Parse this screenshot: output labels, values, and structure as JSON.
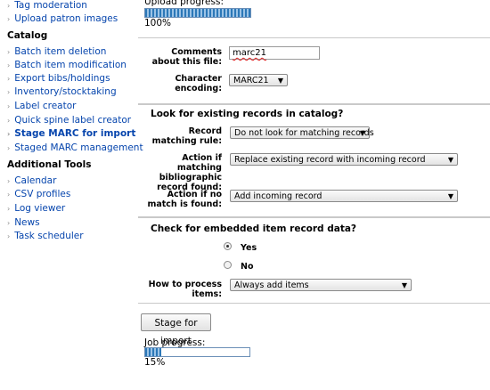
{
  "sidebar": {
    "top_items": [
      "Tag moderation",
      "Upload patron images"
    ],
    "catalog_heading": "Catalog",
    "catalog_items": [
      "Batch item deletion",
      "Batch item modification",
      "Export bibs/holdings",
      "Inventory/stocktaking",
      "Label creator",
      "Quick spine label creator",
      "Stage MARC for import",
      "Staged MARC management"
    ],
    "tools_heading": "Additional Tools",
    "tools_items": [
      "Calendar",
      "CSV profiles",
      "Log viewer",
      "News",
      "Task scheduler"
    ]
  },
  "upload": {
    "label": "Upload progress:",
    "percent": "100%",
    "fraction": 1.0
  },
  "file_info": {
    "comments_label": "Comments about this file:",
    "comments_value": "marc21",
    "encoding_label": "Character encoding:",
    "encoding_value": "MARC21"
  },
  "matching": {
    "legend": "Look for existing records in catalog?",
    "rule_label": "Record matching rule:",
    "rule_value": "Do not look for matching records",
    "match_label": "Action if matching bibliographic record found:",
    "match_value": "Replace existing record with incoming record",
    "nomatch_label": "Action if no match is found:",
    "nomatch_value": "Add incoming record"
  },
  "items": {
    "legend": "Check for embedded item record data?",
    "yes_label": "Yes",
    "no_label": "No",
    "yes_selected": true,
    "process_label": "How to process items:",
    "process_value": "Always add items"
  },
  "stage_button": "Stage for import",
  "job": {
    "label": "Job progress:",
    "percent": "15%",
    "fraction": 0.15
  }
}
